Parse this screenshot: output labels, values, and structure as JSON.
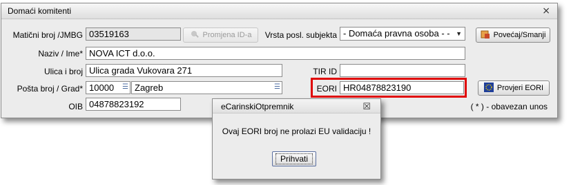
{
  "window": {
    "title": "Domaći komitenti",
    "close_glyph": "⨯"
  },
  "labels": {
    "maticni": "Matični broj /JMBG",
    "naziv": "Naziv / Ime*",
    "ulica": "Ulica i broj",
    "posta": "Pošta broj / Grad*",
    "oib": "OIB",
    "vrsta": "Vrsta posl. subjekta",
    "tir": "TIR ID",
    "eori": "EORI",
    "obavezan": "( * ) - obavezan unos"
  },
  "fields": {
    "maticni": "03519163",
    "naziv": "NOVA ICT d.o.o.",
    "ulica": "Ulica grada Vukovara 271",
    "posta_broj": "10000",
    "grad": "Zagreb",
    "oib": "04878823192",
    "tir": "",
    "eori": "HR04878823190"
  },
  "combo": {
    "vrsta_selected": "- Domaća pravna osoba - -"
  },
  "buttons": {
    "promjena": "Promjena ID-a",
    "povecaj": "Povećaj/Smanji",
    "provjeri": "Provjeri EORI"
  },
  "dialog": {
    "title": "eCarinskiOtpremnik",
    "close_glyph": "☒",
    "message": "Ovaj EORI broj ne prolazi EU validaciju !",
    "ok_label": "Prihvati"
  },
  "colors": {
    "highlight": "#e00000",
    "window_bg": "#ececec"
  }
}
